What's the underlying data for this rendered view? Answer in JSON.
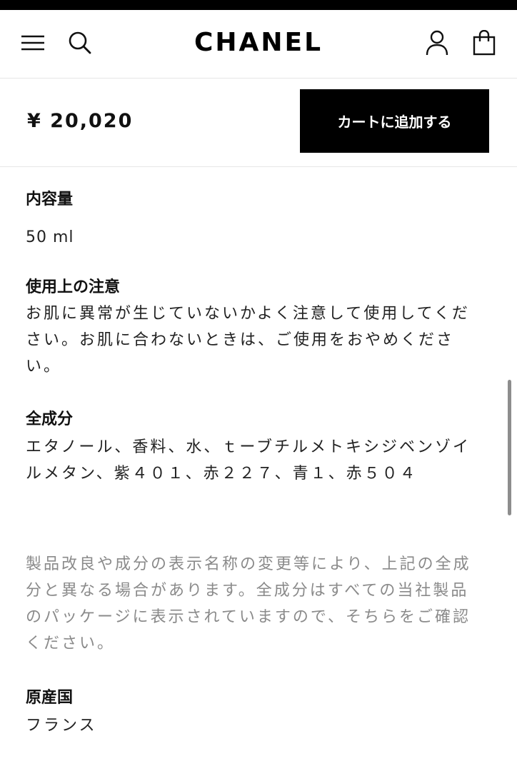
{
  "header": {
    "logo": "CHANEL",
    "icons": [
      "menu-icon",
      "search-icon",
      "account-icon",
      "bag-icon"
    ]
  },
  "purchase": {
    "price": "¥ 20,020",
    "add_to_cart_label": "カートに追加する"
  },
  "details": {
    "volume_heading": "内容量",
    "volume_value": "50 ml",
    "caution_heading": "使用上の注意",
    "caution_text": "お肌に異常が生じていないかよく注意して使用してください。お肌に合わないときは、ご使用をおやめください。",
    "ingredients_heading": "全成分",
    "ingredients_text": "エタノール、香料、水、ｔーブチルメトキシジベンゾイルメタン、紫４０１、赤２２７、青１、赤５０４",
    "notice_text": "製品改良や成分の表示名称の変更等により、上記の全成分と異なる場合があります。全成分はすべての当社製品のパッケージに表示されていますので、そちらをご確認ください。",
    "origin_heading": "原産国",
    "origin_value": "フランス"
  },
  "colors": {
    "accent": "#000000",
    "text": "#111111",
    "muted": "#8a8a8a",
    "divider": "#e6e6e6"
  }
}
